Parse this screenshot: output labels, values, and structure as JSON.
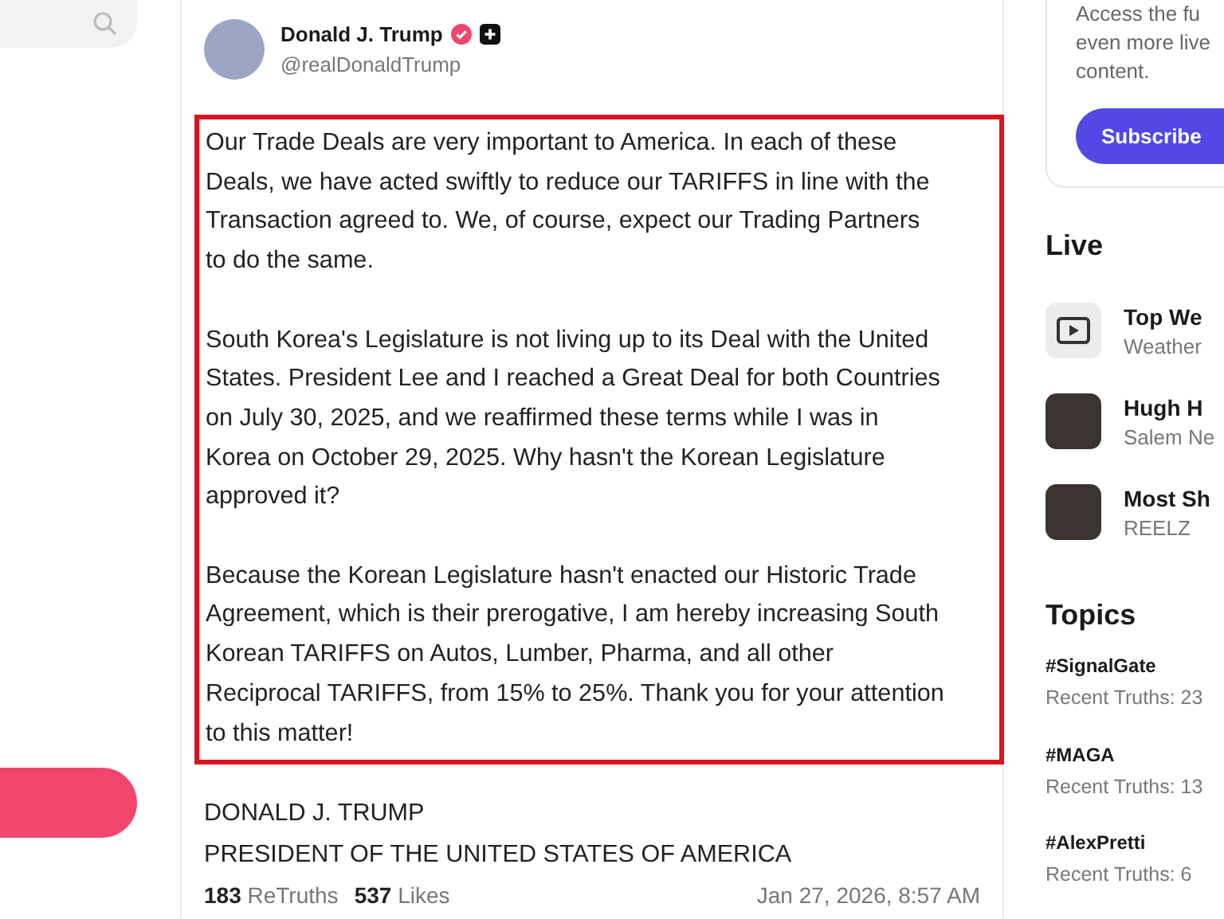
{
  "sidebar": {
    "post_button": {
      "kind": "pill"
    }
  },
  "post": {
    "author": {
      "name": "Donald J. Trump",
      "handle": "@realDonaldTrump",
      "verified": true
    },
    "paragraphs": [
      "Our Trade Deals are very important to America. In each of these Deals, we have acted swiftly to reduce our TARIFFS in line with the Transaction agreed to. We, of course, expect our Trading Partners to do the same.",
      "South Korea's Legislature is not living up to its Deal with the United States. President Lee and I reached a Great Deal for both Countries on July 30, 2025, and we reaffirmed these terms while I was in Korea on October 29, 2025. Why hasn't the Korean Legislature approved it?",
      "Because the Korean Legislature hasn't enacted our Historic Trade Agreement, which is their prerogative, I am hereby increasing South Korean TARIFFS on Autos, Lumber, Pharma, and all other Reciprocal TARIFFS, from 15% to 25%. Thank you for your attention to this matter!"
    ],
    "signature": [
      "DONALD J. TRUMP",
      "PRESIDENT OF THE UNITED STATES OF AMERICA"
    ],
    "retruths": "183",
    "retruths_label": "ReTruths",
    "likes": "537",
    "likes_label": "Likes",
    "timestamp": "Jan 27, 2026, 8:57 AM"
  },
  "right": {
    "promo": {
      "lines": [
        "Access the fu",
        "even more live",
        "content."
      ],
      "button": "Subscribe"
    },
    "live_title": "Live",
    "live": [
      {
        "kind": "tv",
        "title": "Top We",
        "channel": "Weather"
      },
      {
        "kind": "photo",
        "title": "Hugh H",
        "channel": "Salem Ne"
      },
      {
        "kind": "photo",
        "title": "Most Sh",
        "channel": "REELZ"
      }
    ],
    "topics_title": "Topics",
    "topics": [
      {
        "tag": "#SignalGate",
        "count": "Recent Truths: 23"
      },
      {
        "tag": "#MAGA",
        "count": "Recent Truths: 13"
      },
      {
        "tag": "#AlexPretti",
        "count": "Recent Truths: 6"
      }
    ]
  }
}
